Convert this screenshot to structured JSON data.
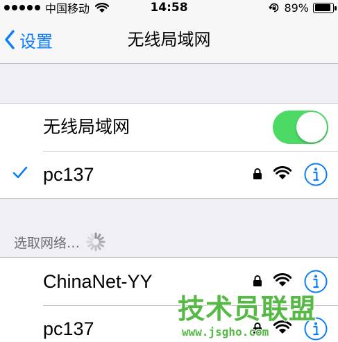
{
  "status_bar": {
    "carrier": "中国移动",
    "time": "14:58",
    "battery": "89%",
    "battery_level": 0.89,
    "signal_icon": "signal-dots-icon",
    "wifi_icon": "wifi-icon",
    "lock_icon": "orientation-lock-icon"
  },
  "nav": {
    "back_label": "设置",
    "title": "无线局域网"
  },
  "wifi_group": {
    "toggle_label": "无线局域网",
    "toggle_on": true,
    "connected_network": "pc137"
  },
  "choose_section": {
    "header": "选取网络…"
  },
  "networks": [
    {
      "name": "ChinaNet-YY"
    },
    {
      "name": "pc137"
    }
  ],
  "watermark": {
    "title": "技术员联盟",
    "url": "www.jsgho.com"
  },
  "colors": {
    "accent": "#0a7dfb",
    "toggle_on": "#4cd964",
    "background": "#efeff4",
    "watermark": "#56b946"
  }
}
